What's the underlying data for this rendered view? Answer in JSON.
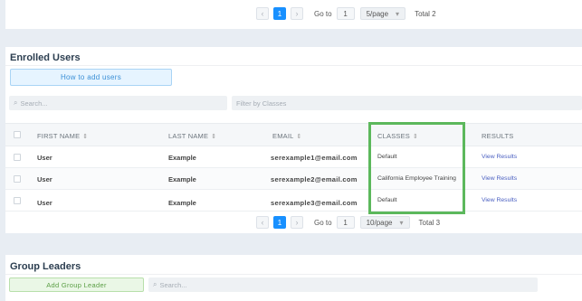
{
  "top_pager": {
    "prev": "‹",
    "page": "1",
    "next": "›",
    "goto_label": "Go to",
    "goto_value": "1",
    "page_size": "5/page",
    "total": "Total 2"
  },
  "enrolled": {
    "title": "Enrolled Users",
    "how_to_button": "How to add users",
    "search_placeholder": "Search...",
    "filter_placeholder": "Filter by Classes",
    "columns": {
      "first_name": "FIRST NAME",
      "last_name": "LAST NAME",
      "email": "EMAIL",
      "classes": "CLASSES",
      "results": "RESULTS"
    },
    "rows": [
      {
        "first": "User",
        "last": "Example",
        "email": "serexample1@email.com",
        "classes": "Default",
        "results": "View Results"
      },
      {
        "first": "User",
        "last": "Example",
        "email": "serexample2@email.com",
        "classes": "California Employee Training",
        "results": "View Results"
      },
      {
        "first": "User",
        "last": "Example",
        "email": "serexample3@email.com",
        "classes": "Default",
        "results": "View Results"
      }
    ],
    "pager": {
      "prev": "‹",
      "page": "1",
      "next": "›",
      "goto_label": "Go to",
      "goto_value": "1",
      "page_size": "10/page",
      "total": "Total 3"
    }
  },
  "group_leaders": {
    "title": "Group Leaders",
    "add_button": "Add Group Leader",
    "search_placeholder": "Search..."
  },
  "colors": {
    "primary": "#1890ff",
    "highlight": "#5cb85c",
    "link": "#4a5fc1"
  }
}
